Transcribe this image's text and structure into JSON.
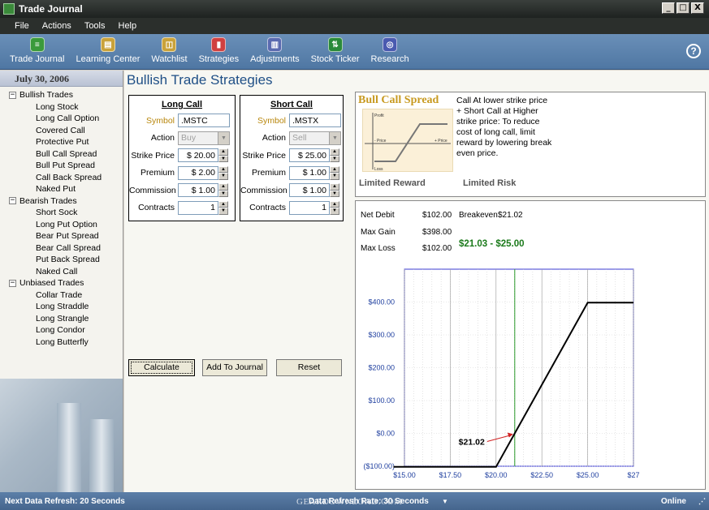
{
  "window": {
    "title": "Trade Journal",
    "buttons": [
      "_",
      "□",
      "X"
    ]
  },
  "menu": [
    "File",
    "Actions",
    "Tools",
    "Help"
  ],
  "toolbar": [
    {
      "label": "Trade Journal",
      "icon": "journal-icon",
      "color": "#3b9a3b"
    },
    {
      "label": "Learning Center",
      "icon": "book-icon",
      "color": "#c9a23a"
    },
    {
      "label": "Watchlist",
      "icon": "watchlist-icon",
      "color": "#c9a23a"
    },
    {
      "label": "Strategies",
      "icon": "chart-icon",
      "color": "#d04040"
    },
    {
      "label": "Adjustments",
      "icon": "adjust-icon",
      "color": "#5a6ab0"
    },
    {
      "label": "Stock Ticker",
      "icon": "ticker-icon",
      "color": "#2a8a3a"
    },
    {
      "label": "Research",
      "icon": "research-icon",
      "color": "#4a5ab0"
    }
  ],
  "sidebar": {
    "date": "July 30, 2006",
    "groups": [
      {
        "label": "Bullish Trades",
        "items": [
          "Long Stock",
          "Long Call Option",
          "Covered Call",
          "Protective Put",
          "Bull Call Spread",
          "Bull Put Spread",
          "Call Back Spread",
          "Naked Put"
        ]
      },
      {
        "label": "Bearish Trades",
        "items": [
          "Short Sock",
          "Long Put Option",
          "Bear Put Spread",
          "Bear Call Spread",
          "Put Back Spread",
          "Naked Call"
        ]
      },
      {
        "label": "Unbiased Trades",
        "items": [
          "Collar Trade",
          "Long Straddle",
          "Long Strangle",
          "Long Condor",
          "Long Butterfly"
        ]
      }
    ]
  },
  "page_title": "Bullish Trade Strategies",
  "long_call": {
    "heading": "Long Call",
    "symbol_label": "Symbol",
    "symbol": ".MSTC",
    "action_label": "Action",
    "action": "Buy",
    "strike_label": "Strike Price",
    "strike": "$ 20.00",
    "premium_label": "Premium",
    "premium": "$ 2.00",
    "commission_label": "Commission",
    "commission": "$ 1.00",
    "contracts_label": "Contracts",
    "contracts": "1"
  },
  "short_call": {
    "heading": "Short Call",
    "symbol_label": "Symbol",
    "symbol": ".MSTX",
    "action_label": "Action",
    "action": "Sell",
    "strike_label": "Strike Price",
    "strike": "$ 25.00",
    "premium_label": "Premium",
    "premium": "$ 1.00",
    "commission_label": "Commission",
    "commission": "$ 1.00",
    "contracts_label": "Contracts",
    "contracts": "1"
  },
  "buttons": {
    "calculate": "Calculate",
    "add_to_journal": "Add To Journal",
    "reset": "Reset"
  },
  "strategy": {
    "name": "Bull Call Spread",
    "description": "Call At lower strike price + Short Call at Higher strike price: To reduce cost of long call, limit reward by lowering break even price.",
    "reward": "Limited Reward",
    "risk": "Limited Risk",
    "mini_labels": {
      "profit": "Profit",
      "loss": "Loss",
      "price_left": "- Price",
      "price_right": "+ Price"
    }
  },
  "results": {
    "net_debit_label": "Net Debit",
    "net_debit": "$102.00",
    "breakeven_label": "Breakeven",
    "breakeven": "$21.02",
    "max_gain_label": "Max Gain",
    "max_gain": "$398.00",
    "max_loss_label": "Max Loss",
    "max_loss": "$102.00",
    "range": "$21.03  -  $25.00"
  },
  "chart_data": {
    "type": "line",
    "title": "",
    "xlabel": "",
    "ylabel": "",
    "x_ticks": [
      "$15.00",
      "$17.50",
      "$20.00",
      "$22.50",
      "$25.00",
      "$27"
    ],
    "x_tick_values": [
      15,
      17.5,
      20,
      22.5,
      25,
      27.5
    ],
    "y_ticks": [
      "($100.00)",
      "$0.00",
      "$100.00",
      "$200.00",
      "$300.00",
      "$400.00"
    ],
    "y_tick_values": [
      -100,
      0,
      100,
      200,
      300,
      400
    ],
    "xlim": [
      15,
      27.5
    ],
    "ylim": [
      -100,
      500
    ],
    "grid": true,
    "series": [
      {
        "x": [
          14.4,
          20,
          25,
          27.5
        ],
        "y": [
          -102,
          -102,
          398,
          398
        ]
      }
    ],
    "marker": {
      "x": 21.02,
      "label": "$21.02",
      "color": "#2a9a2a"
    }
  },
  "status": {
    "next_refresh": "Next Data Refresh:  20 Seconds",
    "refresh_rate": "Data Refresh Rate: 30 Seconds",
    "online": "Online"
  },
  "watermark": "GEARDOWNLOAD.COM"
}
